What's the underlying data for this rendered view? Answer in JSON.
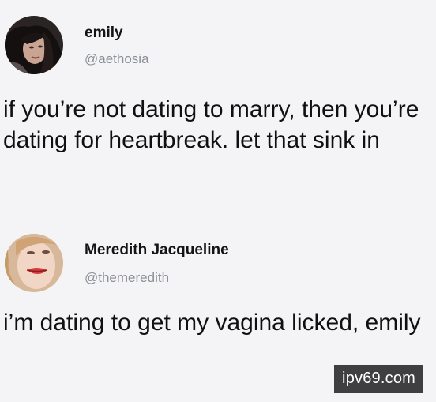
{
  "tweets": [
    {
      "display_name": "emily",
      "handle": "@aethosia",
      "text": "if you’re not dating to marry, then you’re dating for heartbreak. let that sink in"
    },
    {
      "display_name": "Meredith Jacqueline",
      "handle": "@themeredith",
      "text": "i’m dating to get my vagina licked, emily"
    }
  ],
  "watermark": "ipv69.com"
}
